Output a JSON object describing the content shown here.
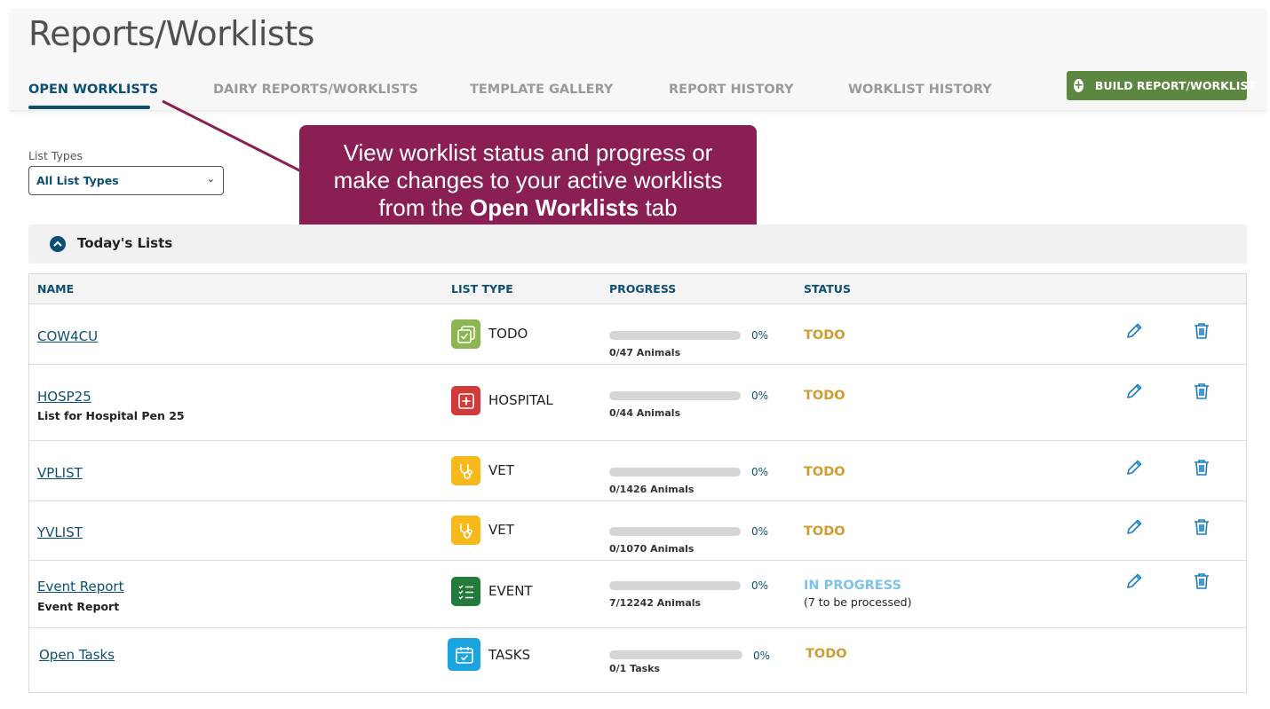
{
  "page": {
    "title": "Reports/Worklists"
  },
  "tabs": [
    {
      "label": "OPEN WORKLISTS",
      "active": true
    },
    {
      "label": "DAIRY REPORTS/WORKLISTS"
    },
    {
      "label": "TEMPLATE GALLERY"
    },
    {
      "label": "REPORT HISTORY"
    },
    {
      "label": "WORKLIST HISTORY"
    }
  ],
  "build_button": {
    "label": "BUILD REPORT/WORKLIST",
    "icon": "plus-circle-icon"
  },
  "filter": {
    "label": "List Types",
    "value": "All List Types"
  },
  "callout": {
    "line1": "View worklist status and progress or",
    "line2": "make changes to your active worklists",
    "line3_pre": "from the ",
    "line3_bold": "Open Worklists",
    "line3_post": " tab"
  },
  "section": {
    "title": "Today's Lists",
    "icon": "chevron-up-icon"
  },
  "table": {
    "headers": {
      "name": "NAME",
      "list_type": "LIST TYPE",
      "progress": "PROGRESS",
      "status": "STATUS"
    },
    "rows": [
      {
        "name": "COW4CU",
        "subtitle": "",
        "type": "TODO",
        "type_icon": "todo-icon",
        "type_color": "#8db651",
        "progress": 0,
        "pct": "0%",
        "count": "0/47 Animals",
        "status": "TODO",
        "status_color": "#d19b2f",
        "note": ""
      },
      {
        "name": "HOSP25",
        "subtitle": "List for Hospital Pen 25",
        "type": "HOSPITAL",
        "type_icon": "hospital-icon",
        "type_color": "#d33a3a",
        "progress": 0,
        "pct": "0%",
        "count": "0/44 Animals",
        "status": "TODO",
        "status_color": "#d19b2f",
        "note": ""
      },
      {
        "name": "VPLIST",
        "subtitle": "",
        "type": "VET",
        "type_icon": "stethoscope-icon",
        "type_color": "#f6b81b",
        "progress": 0,
        "pct": "0%",
        "count": "0/1426 Animals",
        "status": "TODO",
        "status_color": "#d19b2f",
        "note": ""
      },
      {
        "name": "YVLIST",
        "subtitle": "",
        "type": "VET",
        "type_icon": "stethoscope-icon",
        "type_color": "#f6b81b",
        "progress": 0,
        "pct": "0%",
        "count": "0/1070 Animals",
        "status": "TODO",
        "status_color": "#d19b2f",
        "note": ""
      },
      {
        "name": "Event Report",
        "subtitle": "Event Report",
        "type": "EVENT",
        "type_icon": "checklist-icon",
        "type_color": "#237a3a",
        "progress": 0,
        "pct": "0%",
        "count": "7/12242 Animals",
        "status": "IN PROGRESS",
        "status_color": "#7cc3e8",
        "note": "(7 to be processed)"
      },
      {
        "name": "Open Tasks",
        "subtitle": "",
        "type": "TASKS",
        "type_icon": "calendar-check-icon",
        "type_color": "#1ba4e0",
        "progress": 0,
        "pct": "0%",
        "count": "0/1 Tasks",
        "status": "TODO",
        "status_color": "#d19b2f",
        "note": ""
      }
    ],
    "action_icons": {
      "edit": "pencil-icon",
      "delete": "trash-icon"
    }
  }
}
